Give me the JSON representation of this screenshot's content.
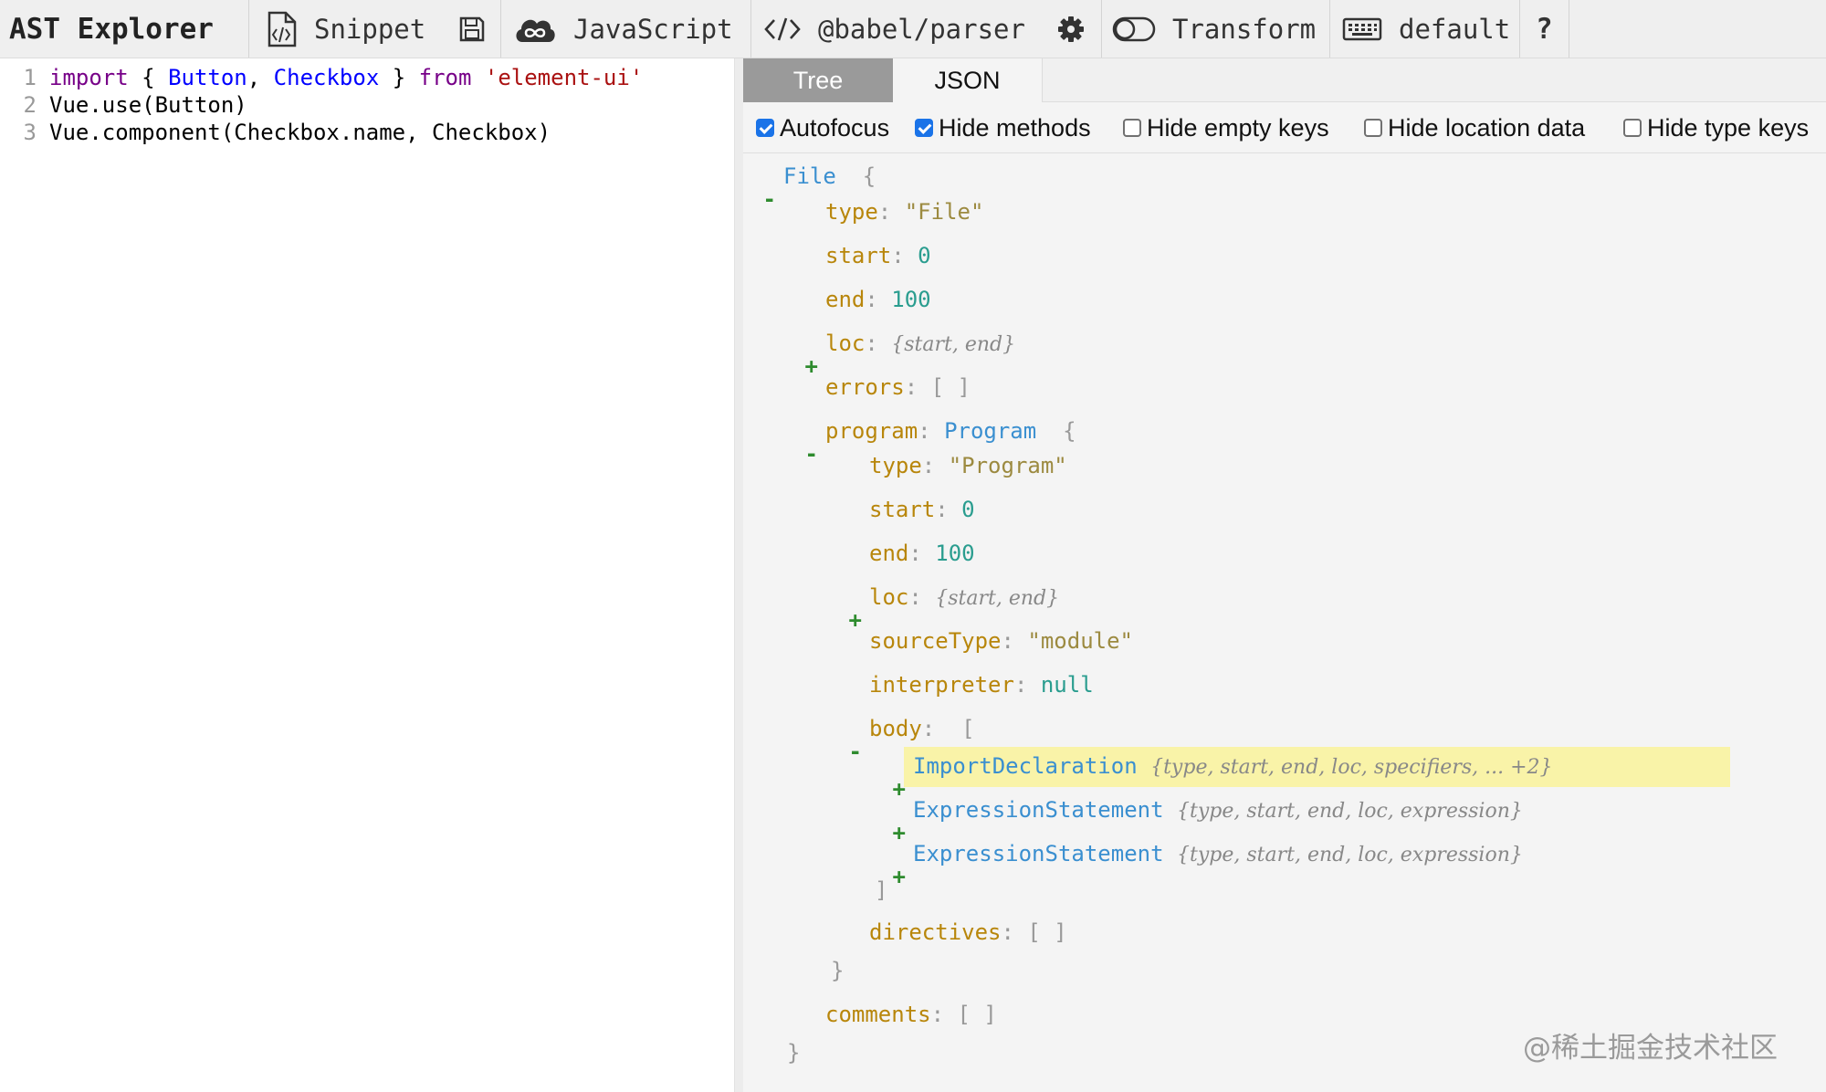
{
  "toolbar": {
    "title": "AST Explorer",
    "snippet": "Snippet",
    "language": "JavaScript",
    "parser": "@babel/parser",
    "transform": "Transform",
    "keymap": "default",
    "help": "?"
  },
  "editor": {
    "lines": [
      {
        "num": "1",
        "tokens": [
          {
            "text": "import",
            "type": "kw"
          },
          {
            "text": " { ",
            "type": "plain"
          },
          {
            "text": "Button",
            "type": "def"
          },
          {
            "text": ", ",
            "type": "plain"
          },
          {
            "text": "Checkbox",
            "type": "def"
          },
          {
            "text": " } ",
            "type": "plain"
          },
          {
            "text": "from",
            "type": "kw"
          },
          {
            "text": " ",
            "type": "plain"
          },
          {
            "text": "'element-ui'",
            "type": "str"
          }
        ]
      },
      {
        "num": "2",
        "tokens": [
          {
            "text": "Vue.use(Button)",
            "type": "plain"
          }
        ]
      },
      {
        "num": "3",
        "tokens": [
          {
            "text": "Vue.component(Checkbox.name, Checkbox)",
            "type": "plain"
          }
        ]
      }
    ]
  },
  "output": {
    "tabs": [
      "Tree",
      "JSON"
    ],
    "options": [
      {
        "label": "Autofocus",
        "checked": true
      },
      {
        "label": "Hide methods",
        "checked": true
      },
      {
        "label": "Hide empty keys",
        "checked": false
      },
      {
        "label": "Hide location data",
        "checked": false
      },
      {
        "label": "Hide type keys",
        "checked": false
      }
    ],
    "tree": [
      {
        "toggle": "-",
        "key": "",
        "type": "File",
        "suffix": "{"
      },
      {
        "key": "type",
        "value": "\"File\"",
        "vtype": "s"
      },
      {
        "key": "start",
        "value": "0",
        "vtype": "n"
      },
      {
        "key": "end",
        "value": "100",
        "vtype": "n"
      },
      {
        "toggle": "+",
        "key": "loc",
        "summary": "{start, end}"
      },
      {
        "key": "errors",
        "value": "[ ]",
        "vtype": "p"
      },
      {
        "toggle": "-",
        "key": "program",
        "type": "Program",
        "suffix": "{"
      },
      {
        "key": "type",
        "value": "\"Program\"",
        "vtype": "s"
      },
      {
        "key": "start",
        "value": "0",
        "vtype": "n"
      },
      {
        "key": "end",
        "value": "100",
        "vtype": "n"
      },
      {
        "toggle": "+",
        "key": "loc",
        "summary": "{start, end}"
      },
      {
        "key": "sourceType",
        "value": "\"module\"",
        "vtype": "s"
      },
      {
        "key": "interpreter",
        "value": "null",
        "vtype": "n"
      },
      {
        "toggle": "-",
        "key": "body",
        "suffix": "["
      },
      {
        "toggle": "+",
        "type": "ImportDeclaration",
        "summary": "{type, start, end, loc, specifiers, ... +2}"
      },
      {
        "toggle": "+",
        "type": "ExpressionStatement",
        "summary": "{type, start, end, loc, expression}"
      },
      {
        "toggle": "+",
        "type": "ExpressionStatement",
        "summary": "{type, start, end, loc, expression}"
      },
      {
        "close": "]"
      },
      {
        "key": "directives",
        "value": "[ ]",
        "vtype": "p"
      },
      {
        "close": "}"
      },
      {
        "key": "comments",
        "value": "[ ]",
        "vtype": "p"
      },
      {
        "close": "}"
      }
    ]
  },
  "watermark": "@稀土掘金技术社区",
  "colors": {
    "accent": "#1a73e8",
    "highlight": "#f9f3a8",
    "tab_active": "#9a9a9a"
  }
}
